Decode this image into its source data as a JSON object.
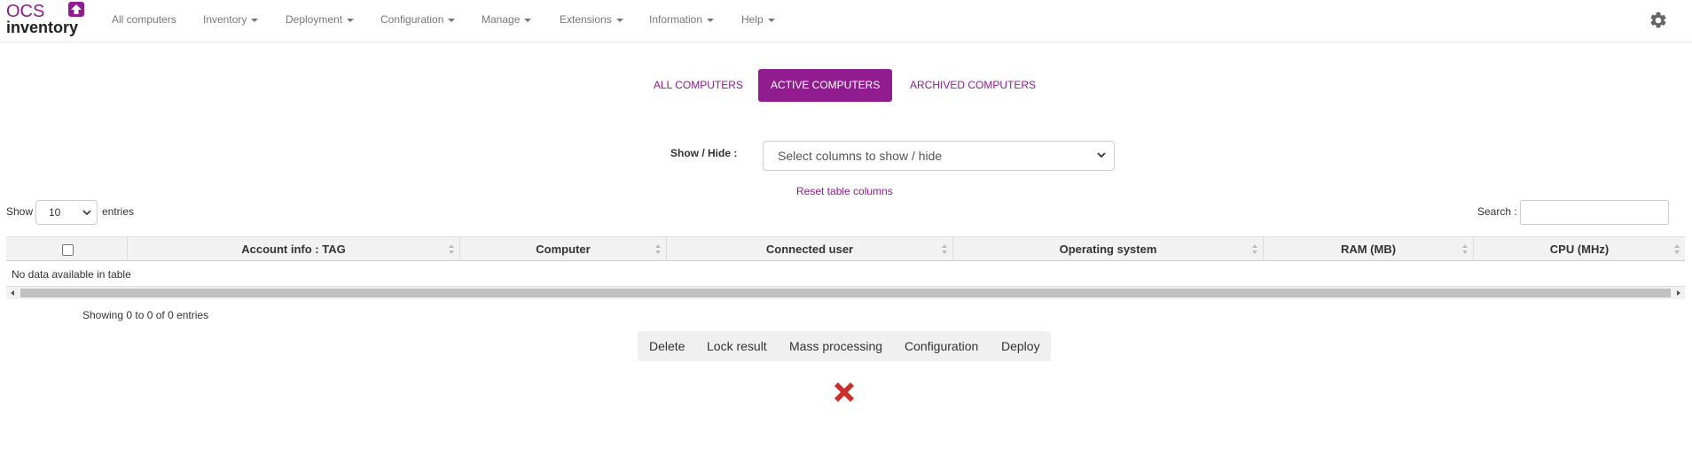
{
  "brand": {
    "logo_top": "OCS",
    "logo_bottom": "inventory"
  },
  "nav": {
    "items": [
      {
        "label": "All computers",
        "dropdown": false
      },
      {
        "label": "Inventory",
        "dropdown": true
      },
      {
        "label": "Deployment",
        "dropdown": true
      },
      {
        "label": "Configuration",
        "dropdown": true
      },
      {
        "label": "Manage",
        "dropdown": true
      },
      {
        "label": "Extensions",
        "dropdown": true
      },
      {
        "label": "Information",
        "dropdown": true
      },
      {
        "label": "Help",
        "dropdown": true
      }
    ],
    "settings_icon": "gear-icon"
  },
  "tabs": [
    {
      "label": "ALL COMPUTERS",
      "active": false
    },
    {
      "label": "ACTIVE COMPUTERS",
      "active": true
    },
    {
      "label": "ARCHIVED COMPUTERS",
      "active": false
    }
  ],
  "columns_filter": {
    "label": "Show / Hide :",
    "selected": "Select columns to show / hide",
    "reset_link": "Reset table columns"
  },
  "table_controls": {
    "show_label": "Show",
    "page_length": "10",
    "entries_label": "entries",
    "search_label": "Search :",
    "search_value": ""
  },
  "table": {
    "columns": [
      {
        "label": ""
      },
      {
        "label": "Account info : TAG"
      },
      {
        "label": "Computer"
      },
      {
        "label": "Connected user"
      },
      {
        "label": "Operating system"
      },
      {
        "label": "RAM (MB)"
      },
      {
        "label": "CPU (MHz)"
      }
    ],
    "empty_message": "No data available in table",
    "info": "Showing 0 to 0 of 0 entries"
  },
  "actions": [
    {
      "label": "Delete"
    },
    {
      "label": "Lock result"
    },
    {
      "label": "Mass processing"
    },
    {
      "label": "Configuration"
    },
    {
      "label": "Deploy"
    }
  ],
  "colors": {
    "brand": "#901c8f",
    "close": "#c9302c"
  }
}
